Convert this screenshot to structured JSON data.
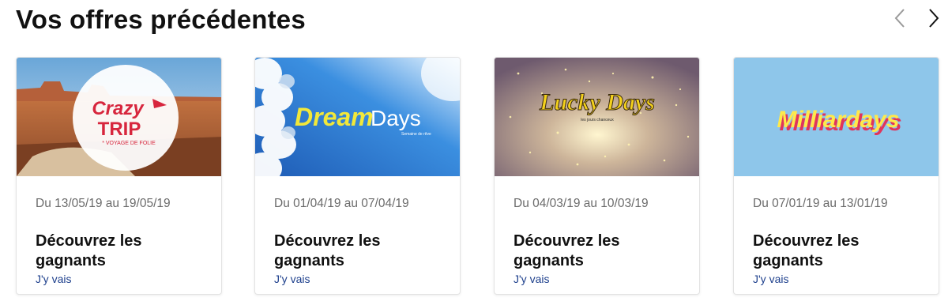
{
  "section": {
    "title": "Vos offres précédentes"
  },
  "nav": {
    "prev_icon": "chevron-left-icon",
    "next_icon": "chevron-right-icon"
  },
  "offers": [
    {
      "logo_text_line1": "Crazy",
      "logo_text_line2": "TRIP",
      "logo_tagline": "* VOYAGE DE FOLIE",
      "dates": "Du 13/05/19 au 19/05/19",
      "heading": "Découvrez les gagnants",
      "link": "J'y vais"
    },
    {
      "logo_text_line1": "Dream",
      "logo_text_line2": "Days",
      "logo_tagline": "Semaine de rêve",
      "dates": "Du 01/04/19 au 07/04/19",
      "heading": "Découvrez les gagnants",
      "link": "J'y vais"
    },
    {
      "logo_text_line1": "Lucky Days",
      "logo_tagline": "les jours chanceux",
      "dates": "Du 04/03/19 au 10/03/19",
      "heading": "Découvrez les gagnants",
      "link": "J'y vais"
    },
    {
      "logo_text_line1": "Milliardays",
      "dates": "Du 07/01/19 au 13/01/19",
      "heading": "Découvrez les gagnants",
      "link": "J'y vais"
    }
  ],
  "colors": {
    "link": "#1d3f8c",
    "date_text": "#6b6b6b",
    "crazy_trip_red": "#d7263d",
    "dream_days_yellow": "#f2e83a",
    "lucky_days_gold": "#f5d21c",
    "milliardays_yellow": "#ffe94a"
  }
}
